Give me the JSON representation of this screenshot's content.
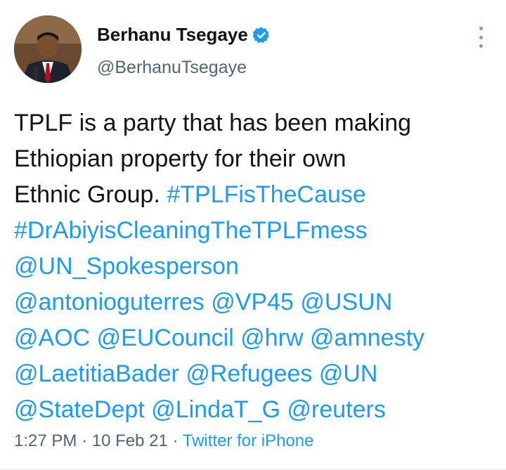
{
  "user": {
    "name": "Berhanu Tsegaye",
    "handle": "@BerhanuTsegaye",
    "verified_icon": "verified-badge-icon"
  },
  "tweet": {
    "text_line1": "TPLF is a party that has been making",
    "text_line2": "Ethiopian property for their own",
    "text_line3": "Ethnic Group.",
    "hashtag1": "#TPLFisTheCause",
    "hashtag2": "#DrAbiyisCleaningTheTPLFmess",
    "mentions": [
      "@UN_Spokesperson",
      "@antonioguterres",
      "@VP45",
      "@USUN",
      "@AOC",
      "@EUCouncil",
      "@hrw",
      "@amnesty",
      "@LaetitiaBader",
      "@Refugees",
      "@UN",
      "@StateDept",
      "@LindaT_G",
      "@reuters"
    ]
  },
  "meta": {
    "time": "1:27 PM",
    "separator": "·",
    "date": "10 Feb 21",
    "source": "Twitter for iPhone"
  },
  "colors": {
    "link": "#1d9bf0",
    "secondary_text": "#536471",
    "primary_text": "#0f1419"
  }
}
